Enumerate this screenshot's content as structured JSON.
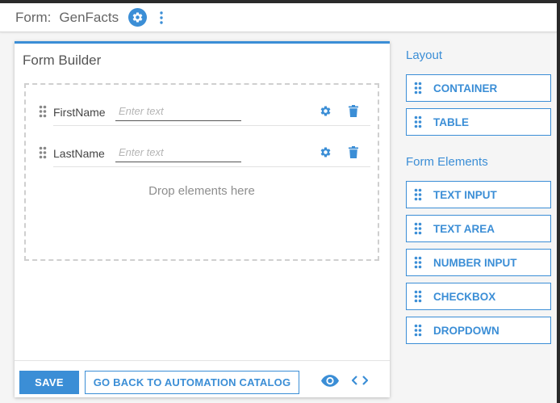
{
  "header": {
    "form_label": "Form:",
    "form_name": "GenFacts",
    "settings_icon": "gear-icon",
    "menu_icon": "kebab-menu-icon"
  },
  "builder": {
    "title": "Form Builder",
    "fields": [
      {
        "label": "FirstName",
        "placeholder": "Enter text",
        "value": ""
      },
      {
        "label": "LastName",
        "placeholder": "Enter text",
        "value": ""
      }
    ],
    "drop_hint": "Drop elements here",
    "save_label": "SAVE",
    "back_label": "GO BACK TO AUTOMATION CATALOG",
    "preview_icon": "eye-icon",
    "code_icon": "code-icon"
  },
  "palette": {
    "layout_heading": "Layout",
    "layout_items": [
      {
        "label": "CONTAINER"
      },
      {
        "label": "TABLE"
      }
    ],
    "elements_heading": "Form Elements",
    "element_items": [
      {
        "label": "TEXT INPUT"
      },
      {
        "label": "TEXT AREA"
      },
      {
        "label": "NUMBER INPUT"
      },
      {
        "label": "CHECKBOX"
      },
      {
        "label": "DROPDOWN"
      }
    ]
  },
  "colors": {
    "accent": "#3b8ed6",
    "background": "#f5f5f5",
    "panel": "#ffffff",
    "dashed_border": "#cfcfcf"
  }
}
